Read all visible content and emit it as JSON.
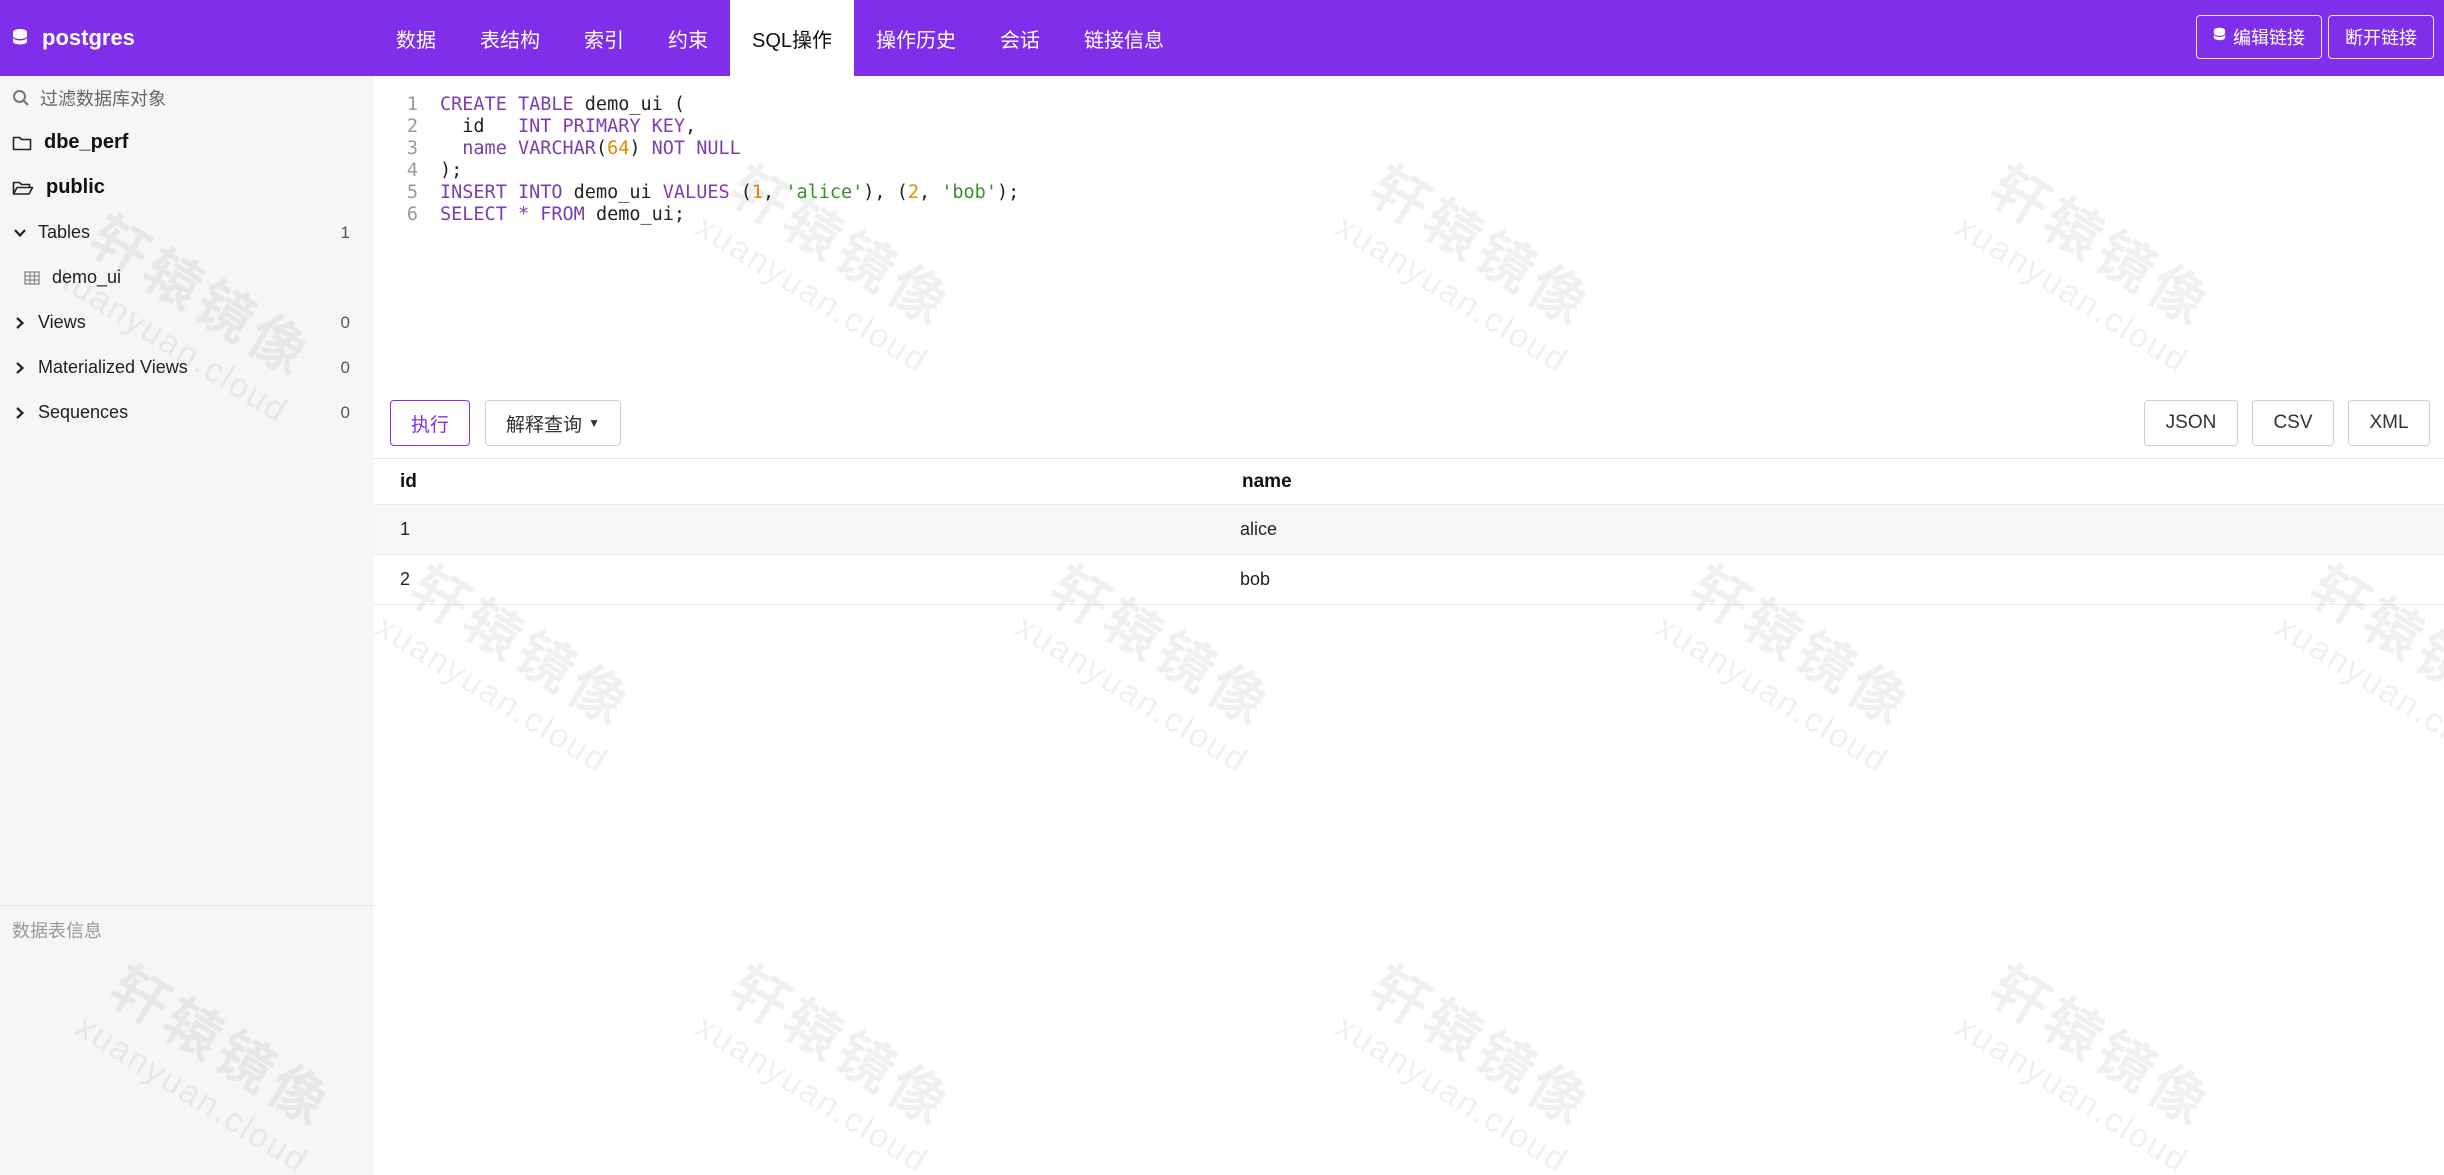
{
  "app": {
    "db_name": "postgres"
  },
  "tabs": [
    {
      "label": "数据",
      "active": false
    },
    {
      "label": "表结构",
      "active": false
    },
    {
      "label": "索引",
      "active": false
    },
    {
      "label": "约束",
      "active": false
    },
    {
      "label": "SQL操作",
      "active": true
    },
    {
      "label": "操作历史",
      "active": false
    },
    {
      "label": "会话",
      "active": false
    },
    {
      "label": "链接信息",
      "active": false
    }
  ],
  "top_actions": {
    "edit_label": "编辑链接",
    "disconnect_label": "断开链接"
  },
  "sidebar": {
    "filter_placeholder": "过滤数据库对象",
    "schemas": [
      {
        "name": "dbe_perf",
        "open": false
      },
      {
        "name": "public",
        "open": true
      }
    ],
    "groups": [
      {
        "label": "Tables",
        "count": "1",
        "expanded": true,
        "items": [
          "demo_ui"
        ]
      },
      {
        "label": "Views",
        "count": "0",
        "expanded": false
      },
      {
        "label": "Materialized Views",
        "count": "0",
        "expanded": false
      },
      {
        "label": "Sequences",
        "count": "0",
        "expanded": false
      }
    ],
    "table_info_label": "数据表信息"
  },
  "editor": {
    "line_numbers": [
      "1",
      "2",
      "3",
      "4",
      "5",
      "6"
    ],
    "lines": [
      [
        {
          "t": "CREATE TABLE",
          "c": "kw"
        },
        {
          "t": " demo_ui (",
          "c": "plain"
        }
      ],
      [
        {
          "t": "  id   ",
          "c": "plain"
        },
        {
          "t": "INT PRIMARY KEY",
          "c": "kw"
        },
        {
          "t": ",",
          "c": "plain"
        }
      ],
      [
        {
          "t": "  name ",
          "c": "kw"
        },
        {
          "t": "VARCHAR",
          "c": "kw"
        },
        {
          "t": "(",
          "c": "plain"
        },
        {
          "t": "64",
          "c": "num"
        },
        {
          "t": ") ",
          "c": "plain"
        },
        {
          "t": "NOT NULL",
          "c": "kw"
        }
      ],
      [
        {
          "t": ");",
          "c": "plain"
        }
      ],
      [
        {
          "t": "INSERT INTO",
          "c": "kw"
        },
        {
          "t": " demo_ui ",
          "c": "plain"
        },
        {
          "t": "VALUES",
          "c": "kw"
        },
        {
          "t": " (",
          "c": "plain"
        },
        {
          "t": "1",
          "c": "num"
        },
        {
          "t": ", ",
          "c": "plain"
        },
        {
          "t": "'alice'",
          "c": "str"
        },
        {
          "t": "), (",
          "c": "plain"
        },
        {
          "t": "2",
          "c": "num"
        },
        {
          "t": ", ",
          "c": "plain"
        },
        {
          "t": "'bob'",
          "c": "str"
        },
        {
          "t": ");",
          "c": "plain"
        }
      ],
      [
        {
          "t": "SELECT",
          "c": "kw"
        },
        {
          "t": " ",
          "c": "plain"
        },
        {
          "t": "*",
          "c": "kw"
        },
        {
          "t": " ",
          "c": "plain"
        },
        {
          "t": "FROM",
          "c": "kw"
        },
        {
          "t": " demo_ui;",
          "c": "plain"
        }
      ]
    ]
  },
  "actions": {
    "execute_label": "执行",
    "explain_label": "解释查询",
    "export": {
      "json": "JSON",
      "csv": "CSV",
      "xml": "XML"
    }
  },
  "results": {
    "columns": [
      "id",
      "name"
    ],
    "rows": [
      [
        "1",
        "alice"
      ],
      [
        "2",
        "bob"
      ]
    ]
  },
  "watermark": {
    "text_cn": "轩辕镜像",
    "text_en": "xuanyuan.cloud"
  },
  "colors": {
    "accent": "#7f2fea",
    "keyword": "#7a3eb1",
    "number": "#e08a00",
    "string": "#3c8d2f"
  }
}
